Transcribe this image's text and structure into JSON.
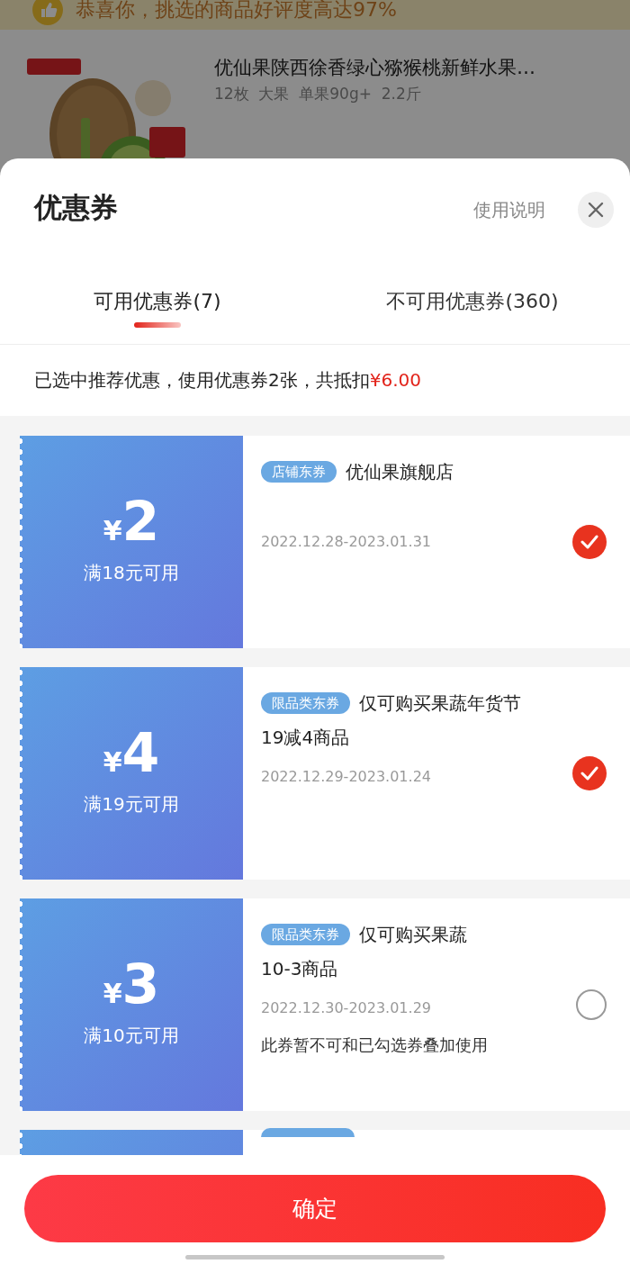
{
  "background": {
    "banner": "恭喜你，挑选的商品好评度高达97%",
    "product": {
      "title": "优仙果陕西徐香绿心猕猴桃新鲜水果…",
      "specs": "12枚  大果  单果90g+  2.2斤"
    }
  },
  "sheet": {
    "title": "优惠券",
    "help_link": "使用说明",
    "tabs": [
      {
        "label": "可用优惠券(7)",
        "selected": true
      },
      {
        "label": "不可用优惠券(360)",
        "selected": false
      }
    ],
    "summary": {
      "text": "已选中推荐优惠，使用优惠券2张，共抵扣",
      "amount": "¥6.00"
    },
    "coupons": [
      {
        "currency": "¥",
        "value": "2",
        "condition": "满18元可用",
        "tag": "店铺东券",
        "title_lines": [
          "优仙果旗舰店"
        ],
        "date": "2022.12.28-2023.01.31",
        "selected": true
      },
      {
        "currency": "¥",
        "value": "4",
        "condition": "满19元可用",
        "tag": "限品类东券",
        "title_lines": [
          "仅可购买果蔬年货节",
          "19减4商品"
        ],
        "date": "2022.12.29-2023.01.24",
        "selected": true
      },
      {
        "currency": "¥",
        "value": "3",
        "condition": "满10元可用",
        "tag": "限品类东券",
        "title_lines": [
          "仅可购买果蔬",
          "10-3商品"
        ],
        "date": "2022.12.30-2023.01.29",
        "note": "此券暂不可和已勾选券叠加使用",
        "selected": false
      }
    ],
    "confirm_button": "确定"
  }
}
